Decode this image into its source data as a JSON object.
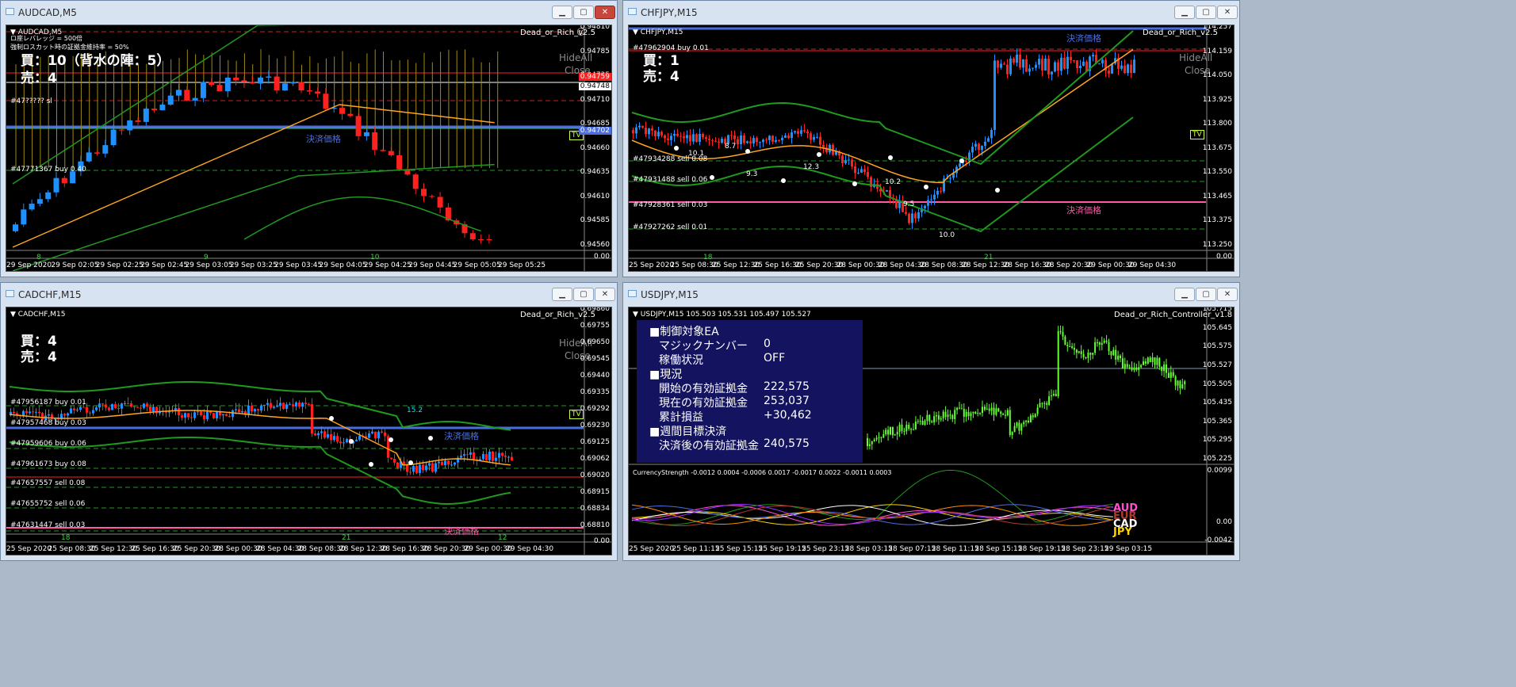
{
  "windows": {
    "w1": {
      "title": "AUDCAD,M5",
      "symbol": "▼ AUDCAD,M5",
      "ea": "Dead_or_Rich_v2.5",
      "info1": "ロ座レバレッジ = 500倍",
      "info2": "強制ロスカット時の証拠金維持率 = 50%",
      "buy": "買：10（背水の陣：5）",
      "sell": "売：4",
      "hideall": "HideAll",
      "close": "Close",
      "orders": [
        "#47????? sl",
        "#47771367 buy 0.40"
      ],
      "settle": "決済価格",
      "tv": "TV",
      "prices": [
        "0.94810",
        "0.94785",
        "0.94735",
        "0.94710",
        "0.94685",
        "0.94660",
        "0.94635",
        "0.94610",
        "0.94585",
        "0.94560"
      ],
      "boxes": [
        "0.94759",
        "0.94748",
        "0.94702"
      ],
      "subticks": [
        "8",
        "9",
        "10"
      ],
      "xlabels": [
        "29 Sep 2020",
        "29 Sep 02:05",
        "29 Sep 02:25",
        "29 Sep 02:45",
        "29 Sep 03:05",
        "29 Sep 03:25",
        "29 Sep 03:45",
        "29 Sep 04:05",
        "29 Sep 04:25",
        "29 Sep 04:45",
        "29 Sep 05:05",
        "29 Sep 05:25"
      ],
      "sub_right": "0.00"
    },
    "w2": {
      "title": "CHFJPY,M15",
      "symbol": "▼ CHFJPY,M15",
      "ea": "Dead_or_Rich_v2.5",
      "buy": "買：1",
      "sell": "売：4",
      "hideall": "HideAll",
      "close": "Close",
      "orders": [
        "#47962904 buy 0.01",
        "#47934288 sell 0.08",
        "#47931488 sell 0.06",
        "#47928361 sell 0.03",
        "#47927262 sell 0.01"
      ],
      "settle_top": "決済価格",
      "settle_bottom": "決済価格",
      "tv": "TV",
      "notes": [
        "10.1",
        "8.7",
        "9.3",
        "12.3",
        "10.2",
        "9.5",
        "10.0"
      ],
      "prices": [
        "114.257",
        "114.159",
        "114.050",
        "113.925",
        "113.800",
        "113.675",
        "113.550",
        "113.465",
        "113.375",
        "113.250"
      ],
      "subticks": [
        "18",
        "21"
      ],
      "xlabels": [
        "25 Sep 2020",
        "25 Sep 08:30",
        "25 Sep 12:30",
        "25 Sep 16:30",
        "25 Sep 20:30",
        "28 Sep 00:30",
        "28 Sep 04:30",
        "28 Sep 08:30",
        "28 Sep 12:30",
        "28 Sep 16:30",
        "28 Sep 20:30",
        "29 Sep 00:30",
        "29 Sep 04:30"
      ],
      "sub_right": "0.00"
    },
    "w3": {
      "title": "CADCHF,M15",
      "symbol": "▼ CADCHF,M15",
      "ea": "Dead_or_Rich_v2.5",
      "buy": "買：4",
      "sell": "売：4",
      "hideall": "HideAll",
      "close": "Close",
      "orders": [
        "#47956187 buy 0.01",
        "#47957468 buy 0.03",
        "#47959606 buy 0.06",
        "#47961673 buy 0.08",
        "#47657557 sell 0.08",
        "#47655752 sell 0.06",
        "#47631447 sell 0.03"
      ],
      "settle_top": "決済価格",
      "settle_bottom": "決済価格",
      "tv": "TV",
      "note": "15.2",
      "prices": [
        "0.69860",
        "0.69755",
        "0.69650",
        "0.69545",
        "0.69440",
        "0.69335",
        "0.69292",
        "0.69230",
        "0.69125",
        "0.69062",
        "0.69020",
        "0.68915",
        "0.68834",
        "0.68810"
      ],
      "subticks": [
        "18",
        "21",
        "12"
      ],
      "xlabels": [
        "25 Sep 2020",
        "25 Sep 08:30",
        "25 Sep 12:30",
        "25 Sep 16:30",
        "25 Sep 20:30",
        "28 Sep 00:30",
        "28 Sep 04:30",
        "28 Sep 08:30",
        "28 Sep 12:30",
        "28 Sep 16:30",
        "28 Sep 20:30",
        "29 Sep 00:30",
        "29 Sep 04:30"
      ],
      "sub_right": "0.00"
    },
    "w4": {
      "title": "USDJPY,M15",
      "symbol": "▼ USDJPY,M15  105.503 105.531 105.497 105.527",
      "ea": "Dead_or_Rich_Controller_v1.8",
      "panel": {
        "h1": "■制御対象EA",
        "magic_label": "マジックナンバー",
        "magic_value": "0",
        "status_label": "稼働状況",
        "status_value": "OFF",
        "h2": "■現況",
        "start_label": "開始の有効証拠金",
        "start_value": "222,575",
        "now_label": "現在の有効証拠金",
        "now_value": "253,037",
        "pl_label": "累計損益",
        "pl_value": "+30,462",
        "h3": "■週間目標決済",
        "after_label": "決済後の有効証拠金",
        "after_value": "240,575"
      },
      "prices": [
        "105.715",
        "105.645",
        "105.575",
        "105.527",
        "105.505",
        "105.435",
        "105.365",
        "105.295",
        "105.225"
      ],
      "sub_label": "CurrencyStrength -0.0012 0.0004 -0.0006 0.0017 -0.0017 0.0022 -0.0011 0.0003",
      "sub_prices": [
        "0.0099",
        "0.00",
        "-0.0042"
      ],
      "currencies": [
        "AUD",
        "EUR",
        "CAD",
        "JPY"
      ],
      "xlabels": [
        "25 Sep 2020",
        "25 Sep 11:15",
        "25 Sep 15:15",
        "25 Sep 19:15",
        "25 Sep 23:15",
        "28 Sep 03:15",
        "28 Sep 07:15",
        "28 Sep 11:15",
        "28 Sep 15:15",
        "28 Sep 19:15",
        "28 Sep 23:15",
        "29 Sep 03:15"
      ]
    }
  },
  "colors": {
    "up": "#1e90ff",
    "down": "#ff2020",
    "band": "#1f9a1f",
    "ma": "#ffa520",
    "settle_blue": "#4a6ee0",
    "settle_pink": "#ff59a8",
    "bull_green": "#66ff33"
  }
}
